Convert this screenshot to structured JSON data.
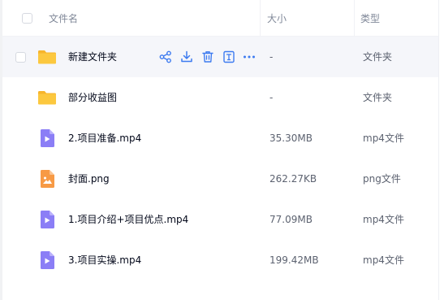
{
  "header": {
    "name_label": "文件名",
    "size_label": "大小",
    "type_label": "类型"
  },
  "colors": {
    "folder": "#fcc33a",
    "video": "#8c7cf7",
    "image": "#f79a45",
    "action": "#3b82f6"
  },
  "rows": [
    {
      "name": "新建文件夹",
      "size": "-",
      "type": "文件夹",
      "icon": "folder-icon",
      "hovered": true
    },
    {
      "name": "部分收益图",
      "size": "-",
      "type": "文件夹",
      "icon": "folder-icon"
    },
    {
      "name": "2.项目准备.mp4",
      "size": "35.30MB",
      "type": "mp4文件",
      "icon": "video-file-icon"
    },
    {
      "name": "封面.png",
      "size": "262.27KB",
      "type": "png文件",
      "icon": "image-file-icon"
    },
    {
      "name": "1.项目介绍+项目优点.mp4",
      "size": "77.09MB",
      "type": "mp4文件",
      "icon": "video-file-icon"
    },
    {
      "name": "3.项目实操.mp4",
      "size": "199.42MB",
      "type": "mp4文件",
      "icon": "video-file-icon"
    }
  ],
  "row_actions": [
    "share-icon",
    "download-icon",
    "delete-icon",
    "rename-icon",
    "more-icon"
  ]
}
